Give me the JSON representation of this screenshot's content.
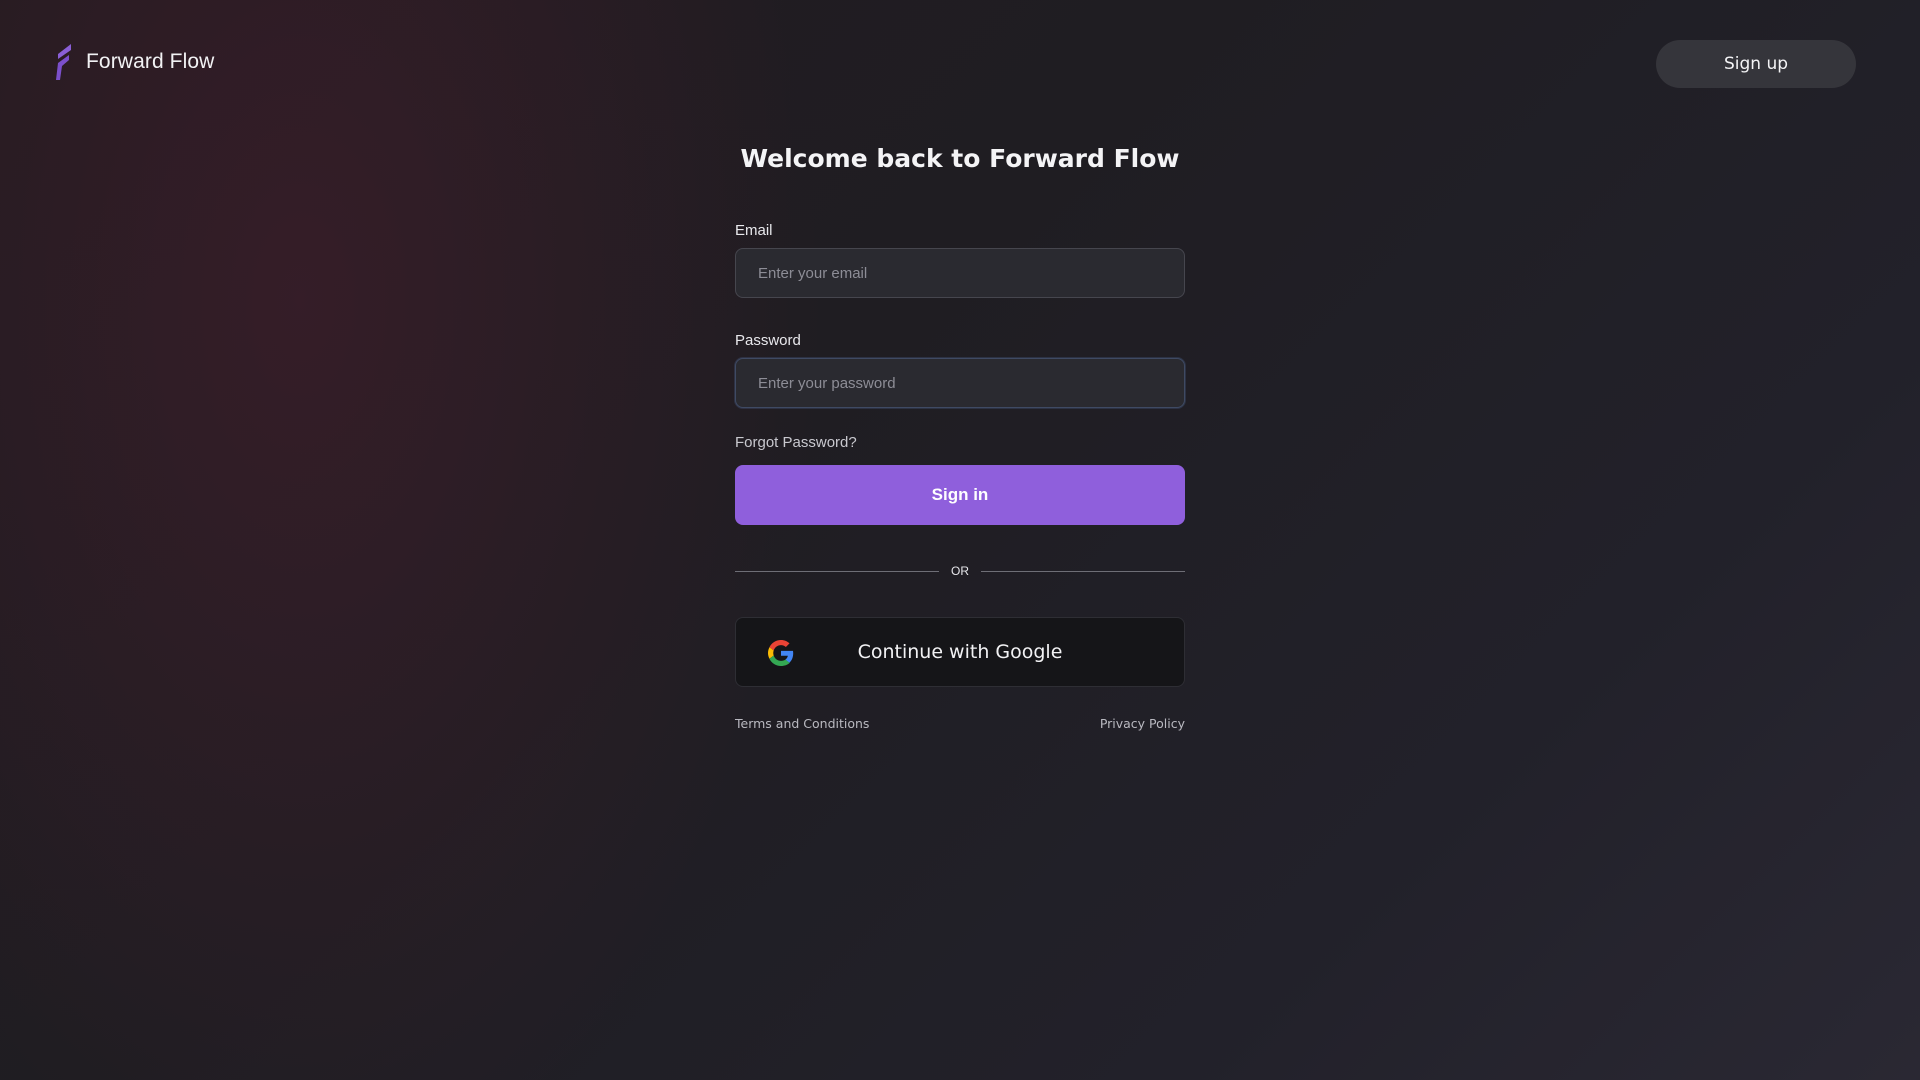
{
  "brand": {
    "name": "Forward Flow",
    "logo_icon": "forward-flow-logo-icon",
    "accent_color": "#8f5fdc"
  },
  "header": {
    "signup_label": "Sign up"
  },
  "main": {
    "title": "Welcome back to Forward Flow",
    "email": {
      "label": "Email",
      "placeholder": "Enter your email",
      "value": ""
    },
    "password": {
      "label": "Password",
      "placeholder": "Enter your password",
      "value": ""
    },
    "forgot_label": "Forgot Password?",
    "signin_label": "Sign in",
    "divider_label": "OR",
    "google": {
      "icon": "google-icon",
      "label": "Continue with Google"
    },
    "footer": {
      "terms_label": "Terms and Conditions",
      "privacy_label": "Privacy Policy"
    }
  }
}
